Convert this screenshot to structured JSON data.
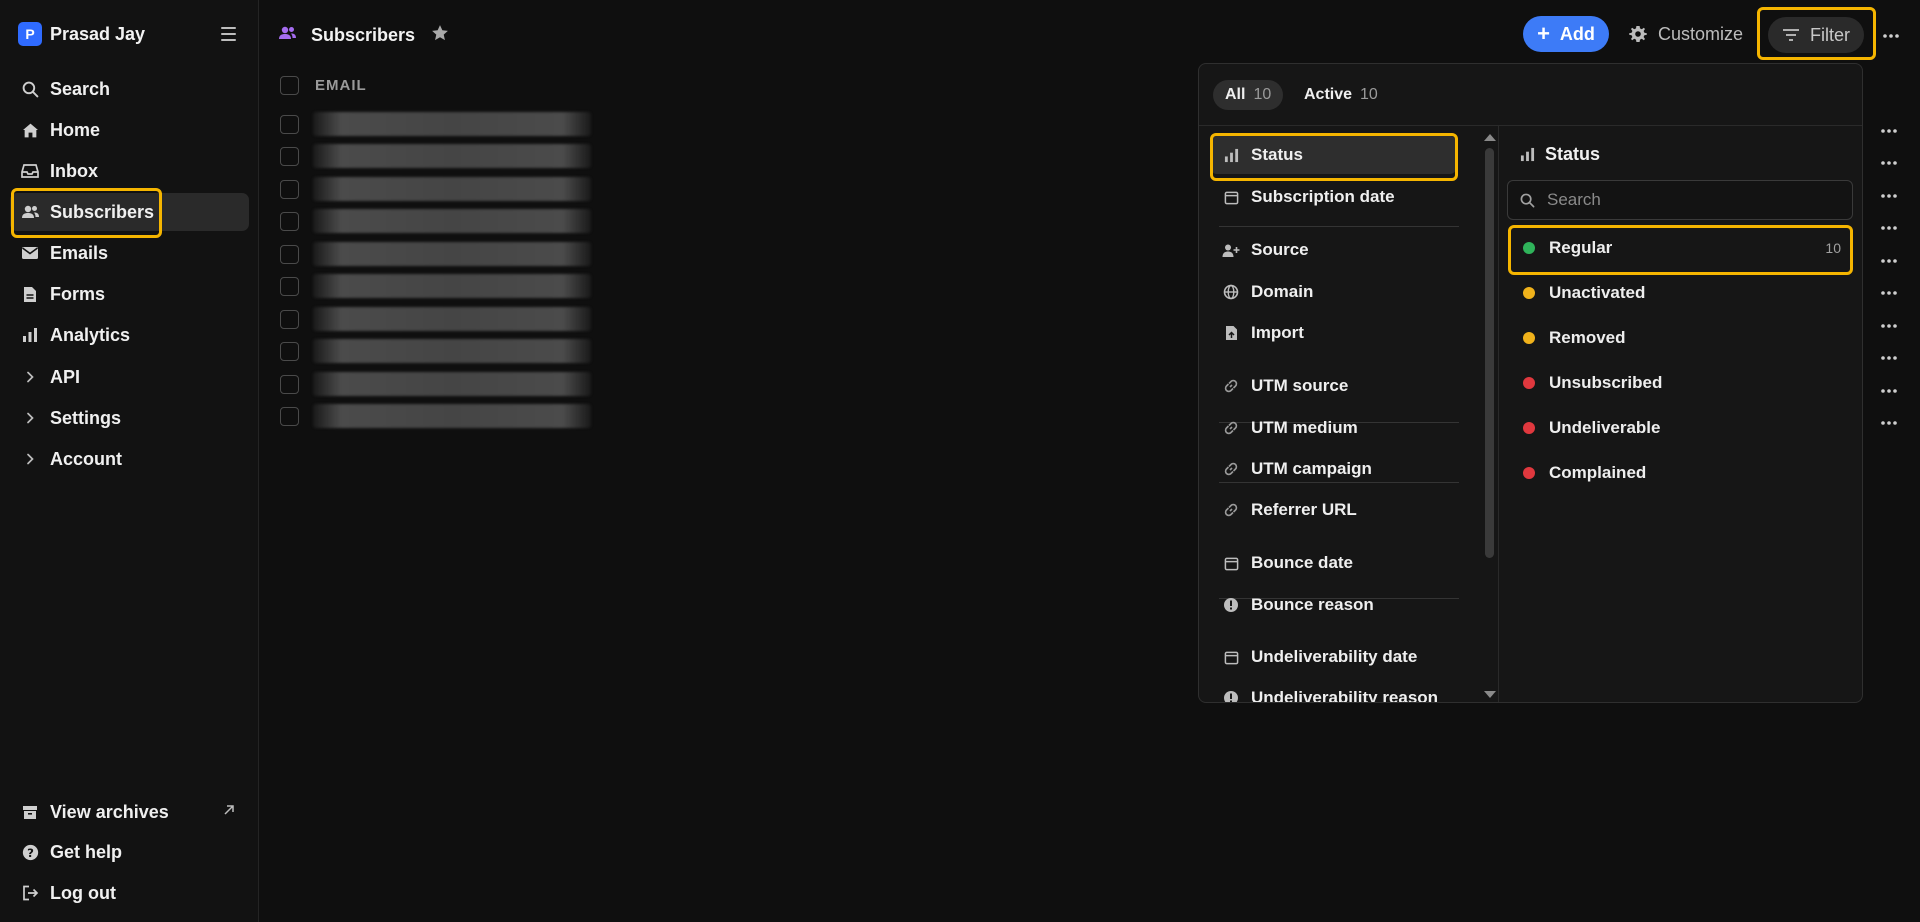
{
  "brand": {
    "letter": "P",
    "name": "Prasad Jay"
  },
  "sidebar": {
    "items": [
      {
        "label": "Search",
        "icon": "search-icon"
      },
      {
        "label": "Home",
        "icon": "home-icon"
      },
      {
        "label": "Inbox",
        "icon": "inbox-icon"
      },
      {
        "label": "Subscribers",
        "icon": "users-icon"
      },
      {
        "label": "Emails",
        "icon": "mail-icon"
      },
      {
        "label": "Forms",
        "icon": "form-icon"
      },
      {
        "label": "Analytics",
        "icon": "bar-chart-icon"
      },
      {
        "label": "API",
        "icon": "chevron-right-icon"
      },
      {
        "label": "Settings",
        "icon": "chevron-right-icon"
      },
      {
        "label": "Account",
        "icon": "chevron-right-icon"
      }
    ],
    "footer": [
      {
        "label": "View archives",
        "icon": "archive-icon"
      },
      {
        "label": "Get help",
        "icon": "help-icon"
      },
      {
        "label": "Log out",
        "icon": "logout-icon"
      }
    ]
  },
  "header": {
    "title": "Subscribers",
    "add_label": "Add",
    "customize_label": "Customize",
    "filter_label": "Filter"
  },
  "table": {
    "column_email": "EMAIL",
    "row_count": 10
  },
  "filter": {
    "tabs": [
      {
        "label": "All",
        "count": "10"
      },
      {
        "label": "Active",
        "count": "10"
      }
    ],
    "fields": [
      "Status",
      "Subscription date",
      "Source",
      "Domain",
      "Import",
      "UTM source",
      "UTM medium",
      "UTM campaign",
      "Referrer URL",
      "Bounce date",
      "Bounce reason",
      "Undeliverability date",
      "Undeliverability reason"
    ],
    "panel_title": "Status",
    "search_placeholder": "Search",
    "options": [
      {
        "label": "Regular",
        "count": "10",
        "color": "#2fb35a"
      },
      {
        "label": "Unactivated",
        "count": "",
        "color": "#f0b21b"
      },
      {
        "label": "Removed",
        "count": "",
        "color": "#f0b21b"
      },
      {
        "label": "Unsubscribed",
        "count": "",
        "color": "#e0383e"
      },
      {
        "label": "Undeliverable",
        "count": "",
        "color": "#e0383e"
      },
      {
        "label": "Complained",
        "count": "",
        "color": "#e0383e"
      }
    ]
  },
  "colors": {
    "accent": "#3d7bf7",
    "highlight": "#f5b500"
  }
}
